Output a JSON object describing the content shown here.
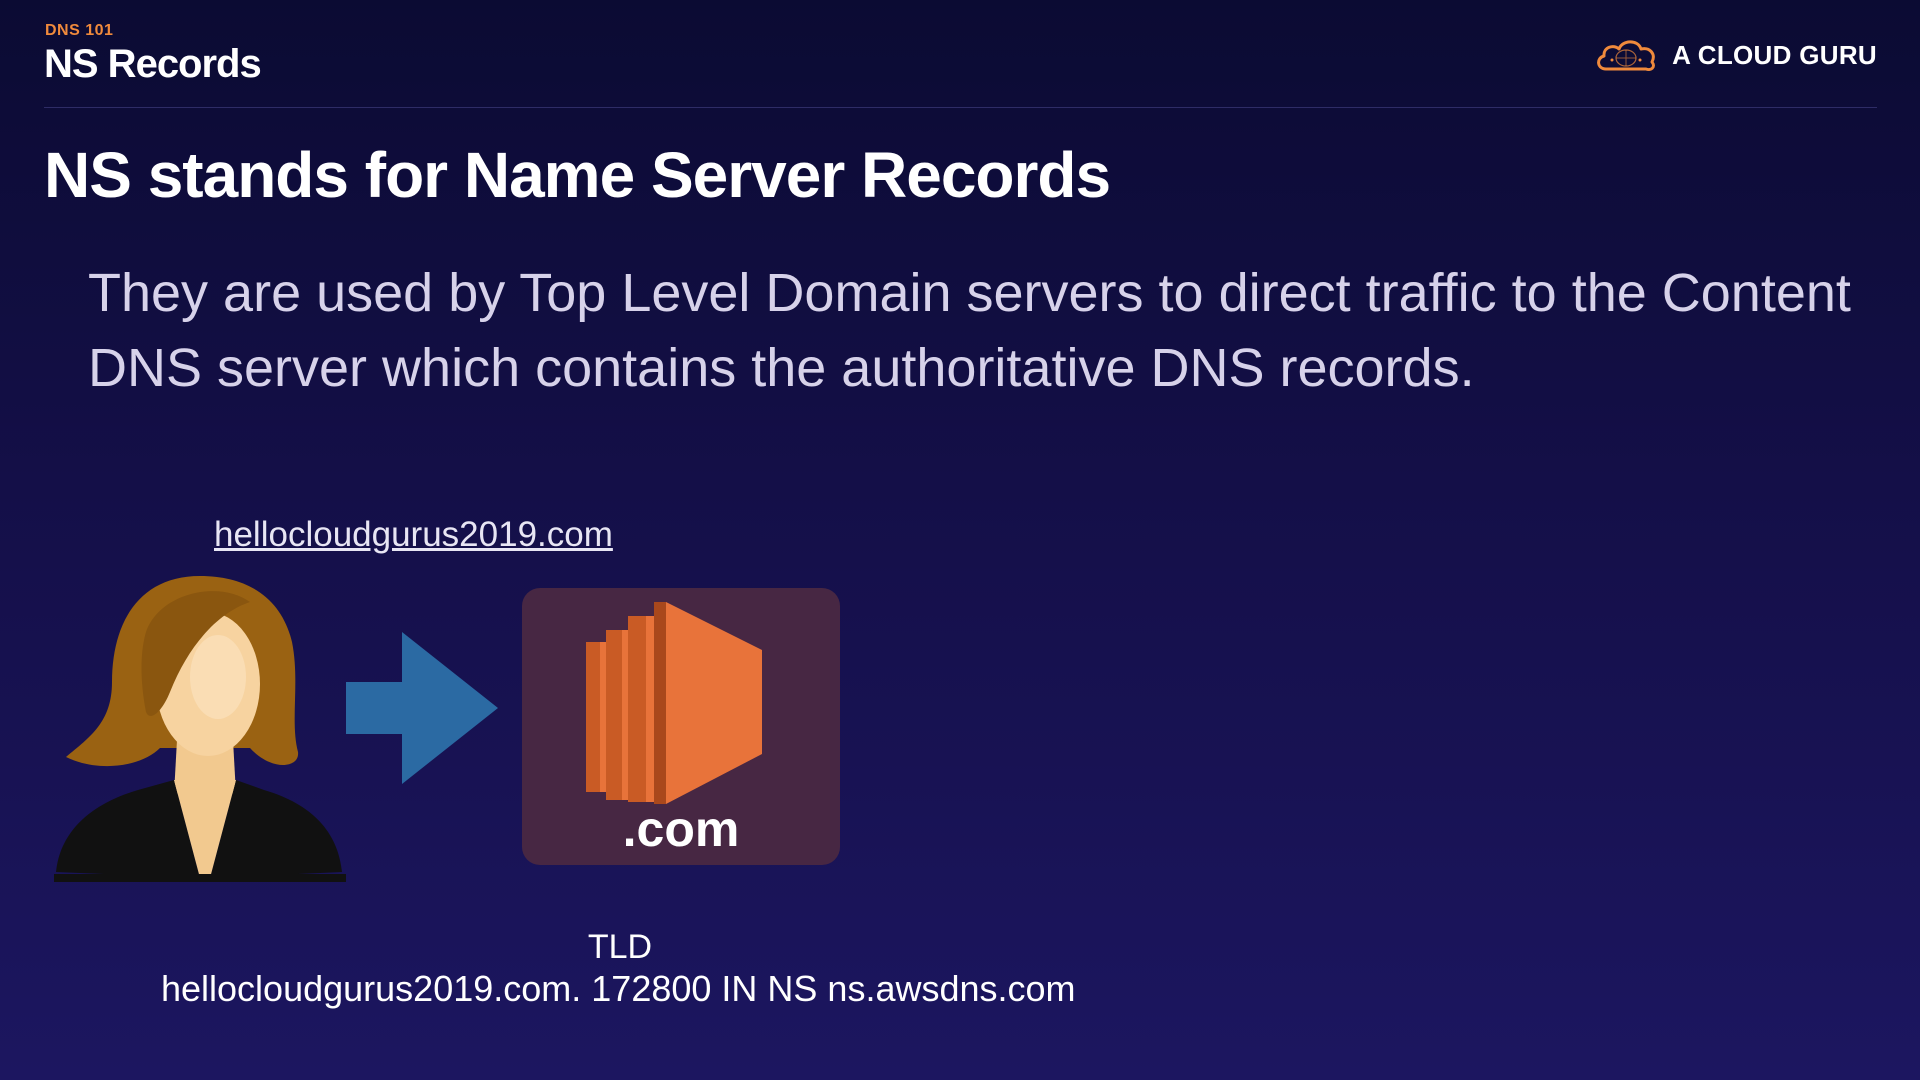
{
  "header": {
    "kicker": "DNS 101",
    "title": "NS Records"
  },
  "brand": {
    "icon": "cloud-icon",
    "name": "A CLOUD GURU",
    "accent_color": "#f08a3c"
  },
  "slide": {
    "heading": "NS stands for Name Server Records",
    "body": "They are used by Top Level Domain servers to direct traffic to the Content DNS server which contains the authoritative DNS records."
  },
  "diagram": {
    "domain": "hellocloudgurus2019.com",
    "user_icon": "user-icon",
    "arrow_icon": "arrow-right-icon",
    "arrow_color": "#2b6aa3",
    "server_icon": "server-icon",
    "server_color": "#e8733a",
    "tld_label": ".com",
    "tld_caption": "TLD",
    "ns_record": "hellocloudgurus2019.com. 172800 IN NS ns.awsdns.com"
  }
}
